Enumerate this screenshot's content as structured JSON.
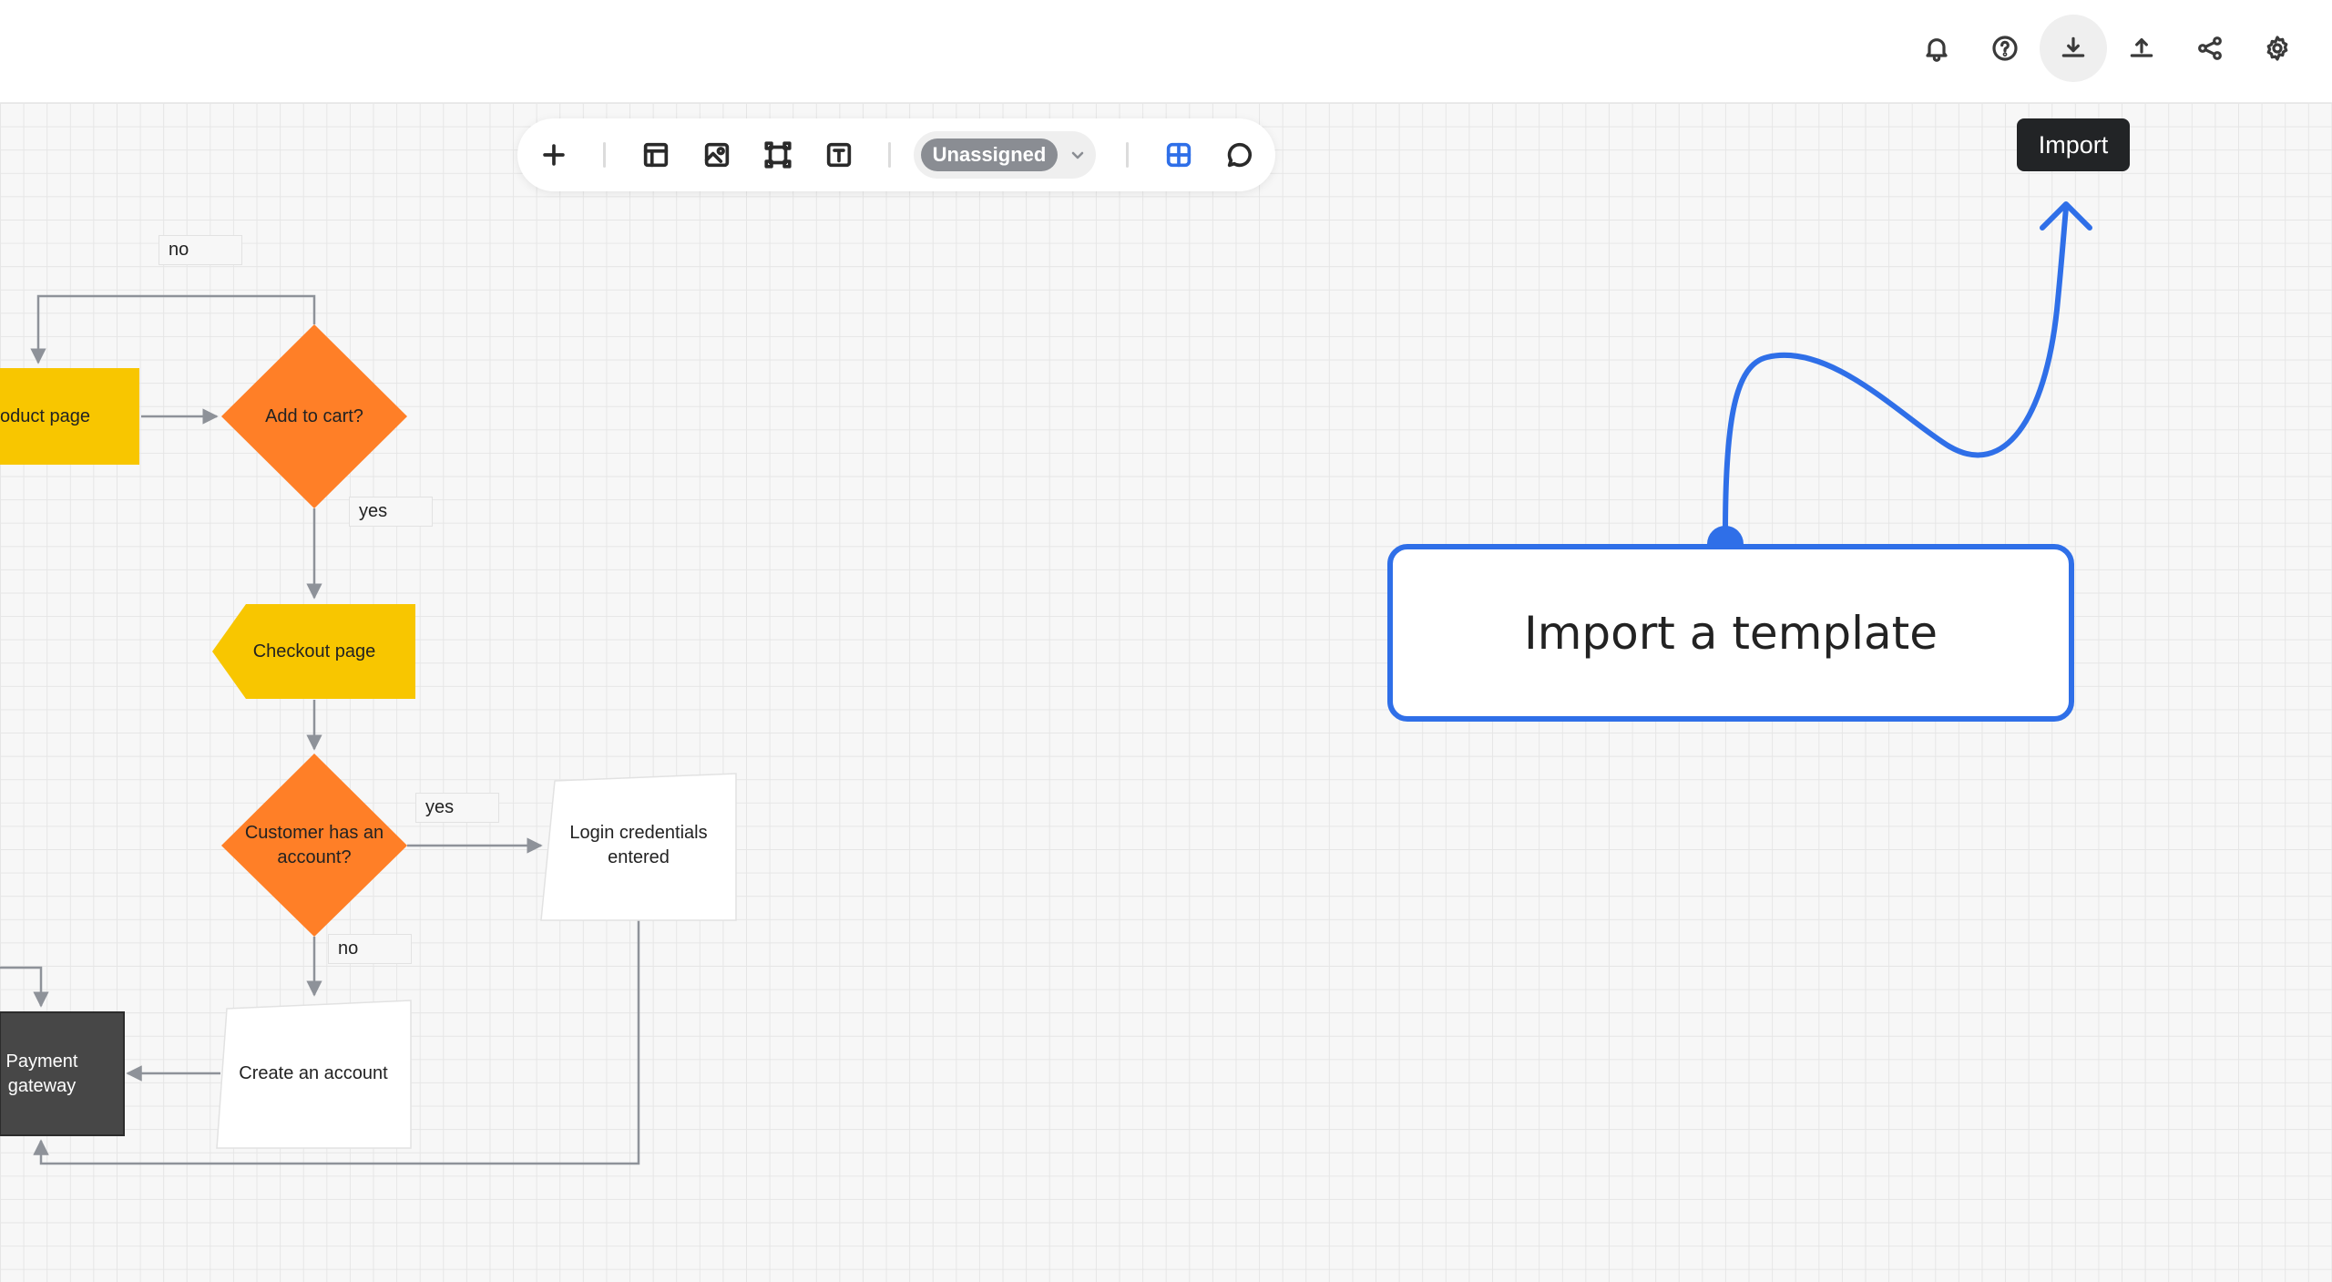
{
  "topbar": {
    "icons": [
      "bell-icon",
      "help-icon",
      "download-import-icon",
      "upload-export-icon",
      "share-icon",
      "settings-gear-icon"
    ]
  },
  "toolbar": {
    "assignee": "Unassigned",
    "icons": [
      "plus-icon",
      "template-layout-icon",
      "image-icon",
      "frame-icon",
      "text-icon",
      "grid-view-icon",
      "comment-icon"
    ]
  },
  "tooltip": {
    "label": "Import"
  },
  "callout": {
    "text": "Import a template"
  },
  "flowchart": {
    "nodes": {
      "product_page": "oduct page",
      "add_to_cart": "Add to cart?",
      "checkout": "Checkout page",
      "has_account_line1": "Customer has an",
      "has_account_line2": "account?",
      "login_line1": "Login credentials",
      "login_line2": "entered",
      "create_account": "Create an account",
      "payment_line1": "Payment",
      "payment_line2": "gateway"
    },
    "edge_labels": {
      "no_top": "no",
      "yes_cart": "yes",
      "yes_account": "yes",
      "no_account": "no"
    }
  },
  "colors": {
    "accent": "#2f6fe8",
    "decision": "#ff7f27",
    "page": "#f8c600",
    "dark_node": "#474747",
    "connector": "#8e9299"
  }
}
